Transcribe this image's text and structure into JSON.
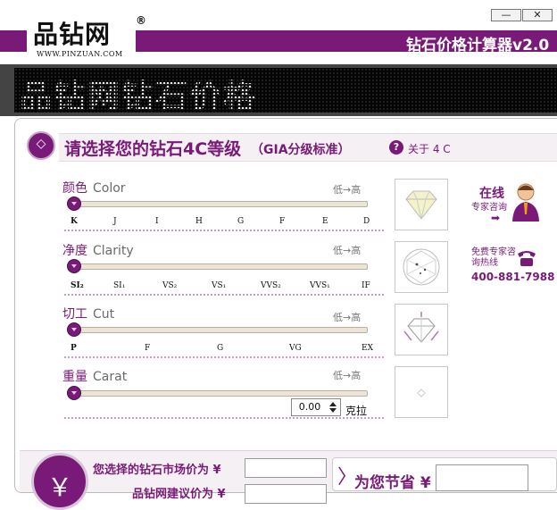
{
  "window": {
    "logo_cn": "品钻网",
    "logo_reg": "®",
    "logo_url": "WWW.PINZUAN.COM",
    "title": "钻石价格计算器v2.0",
    "btn_minimize": "—",
    "btn_close": "✕"
  },
  "marquee": {
    "text": "品钻网钻石价格"
  },
  "header": {
    "title": "请选择您的钻石4C等级",
    "subtitle": "（GIA分级标准）",
    "about_icon": "?",
    "about_label": "关于 4 C"
  },
  "factors": {
    "color": {
      "cn": "颜色",
      "en": "Color",
      "low_high": "低→高",
      "ticks": [
        "K",
        "J",
        "I",
        "H",
        "G",
        "F",
        "E",
        "D"
      ],
      "selected": "K"
    },
    "clarity": {
      "cn": "净度",
      "en": "Clarity",
      "low_high": "低→高",
      "ticks": [
        "SI₂",
        "SI₁",
        "VS₂",
        "VS₁",
        "VVS₂",
        "VVS₁",
        "IF"
      ],
      "selected": "SI₂"
    },
    "cut": {
      "cn": "切工",
      "en": "Cut",
      "low_high": "低→高",
      "ticks": [
        "P",
        "F",
        "G",
        "VG",
        "EX"
      ],
      "selected": "P"
    },
    "carat": {
      "cn": "重量",
      "en": "Carat",
      "low_high": "低→高",
      "value": "0.00",
      "unit": "克拉"
    }
  },
  "side": {
    "online": "在线",
    "consult": "专家咨询",
    "arrow": "➡",
    "hotline": "免费专家咨询热线",
    "phone": "400-881-7988"
  },
  "bottom": {
    "yen_symbol": "￥",
    "market_label": "您选择的钻石市场价为 ¥",
    "pinzuan_label": "品钻网建议价为 ¥",
    "save_chevron": "〉",
    "save_label": "为您节省 ¥"
  },
  "colors": {
    "accent": "#7a1a78",
    "dots": "#c79bc6"
  }
}
